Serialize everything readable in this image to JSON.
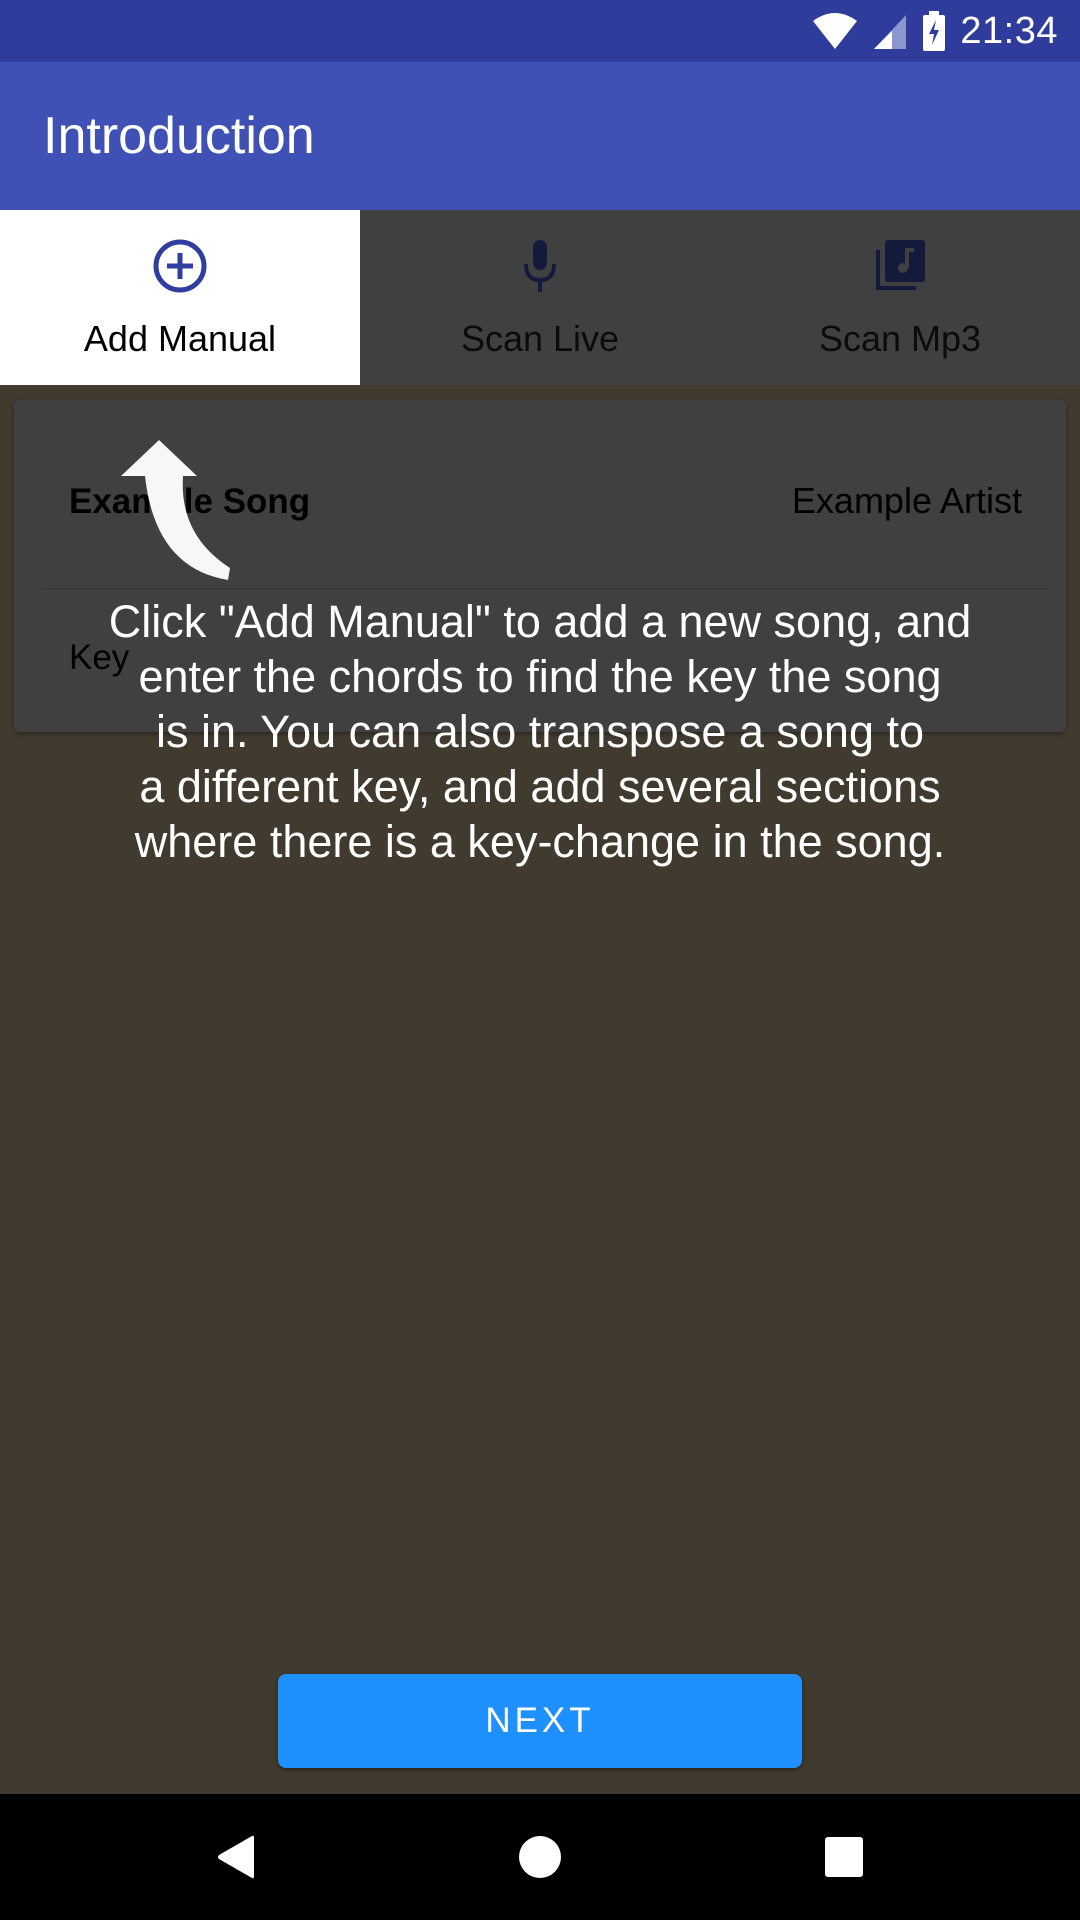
{
  "status_bar": {
    "time": "21:34",
    "icons": [
      "wifi-icon",
      "cell-signal-icon",
      "battery-charging-icon"
    ]
  },
  "app_bar": {
    "title": "Introduction"
  },
  "tabs": [
    {
      "label": "Add Manual",
      "icon": "add-circle-icon",
      "active": true
    },
    {
      "label": "Scan Live",
      "icon": "microphone-icon",
      "active": false
    },
    {
      "label": "Scan Mp3",
      "icon": "music-library-icon",
      "active": false
    }
  ],
  "song_card": {
    "title": "Example Song",
    "artist": "Example Artist",
    "key_label": "Key"
  },
  "tutorial": {
    "text": "Click \"Add Manual\" to add a new song, and\nenter the chords to find the key the song\nis in.  You can also transpose a song to\na different key, and add several sections\nwhere there is a key-change in the song.",
    "pointer_icon": "curved-arrow-up-icon"
  },
  "next_button": {
    "label": "NEXT"
  },
  "nav_bar": {
    "buttons": [
      "back",
      "home",
      "recents"
    ]
  },
  "colors": {
    "status_bar": "#2f3c9b",
    "app_bar": "#3f51b5",
    "accent_icon": "#303f9f",
    "next_button": "#1e90ff",
    "scrim": "#413a2e"
  }
}
